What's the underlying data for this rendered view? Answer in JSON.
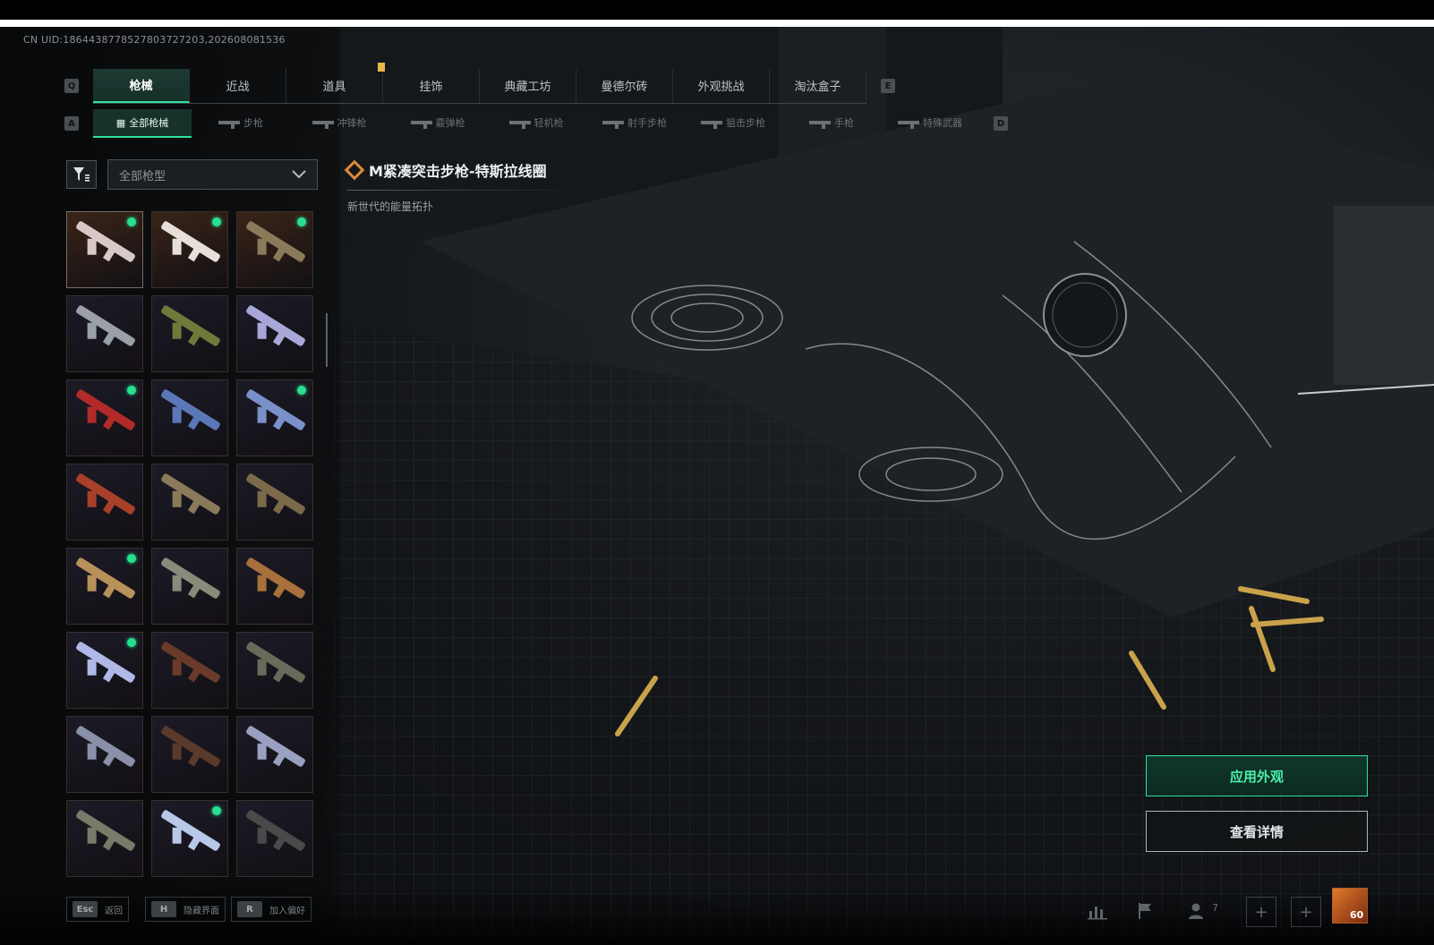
{
  "uid_text": "CN UID:1864438778527803727203,202608081536",
  "main_tabs": [
    {
      "label": "枪械",
      "active": true
    },
    {
      "label": "近战",
      "active": false
    },
    {
      "label": "道具",
      "active": false
    },
    {
      "label": "挂饰",
      "active": false
    },
    {
      "label": "典藏工坊",
      "active": false
    },
    {
      "label": "曼德尔砖",
      "active": false
    },
    {
      "label": "外观挑战",
      "active": false
    },
    {
      "label": "淘汰盒子",
      "active": false
    }
  ],
  "tab_keys": {
    "prev": "Q",
    "next": "E"
  },
  "sub_tabs": [
    {
      "label": "全部枪械",
      "active": true
    },
    {
      "label": "步枪",
      "active": false
    },
    {
      "label": "冲锋枪",
      "active": false
    },
    {
      "label": "霰弹枪",
      "active": false
    },
    {
      "label": "轻机枪",
      "active": false
    },
    {
      "label": "射手步枪",
      "active": false
    },
    {
      "label": "狙击步枪",
      "active": false
    },
    {
      "label": "手枪",
      "active": false
    },
    {
      "label": "特殊武器",
      "active": false
    }
  ],
  "sub_tab_keys": {
    "prev": "A",
    "next": "D"
  },
  "filter": {
    "dropdown_value": "全部枪型"
  },
  "skins": [
    {
      "name": "skin-1",
      "color": "#d8c8c8",
      "bg": "#3a2418",
      "new": true
    },
    {
      "name": "skin-2",
      "color": "#e6e0d8",
      "bg": "#3a2418",
      "new": true
    },
    {
      "name": "skin-3",
      "color": "#8a7a5a",
      "bg": "#3a2418",
      "new": true
    },
    {
      "name": "skin-4",
      "color": "#9aa0a6",
      "bg": "#1c1a26",
      "new": false
    },
    {
      "name": "skin-5",
      "color": "#6f7a3a",
      "bg": "#1c1a26",
      "new": false
    },
    {
      "name": "skin-6",
      "color": "#a8a8d8",
      "bg": "#1c1a26",
      "new": false
    },
    {
      "name": "skin-7",
      "color": "#b22a2a",
      "bg": "#1c1a26",
      "new": true
    },
    {
      "name": "skin-8",
      "color": "#5a78b8",
      "bg": "#1c1a26",
      "new": false
    },
    {
      "name": "skin-9",
      "color": "#7a90c8",
      "bg": "#1c1a26",
      "new": true
    },
    {
      "name": "skin-10",
      "color": "#a8402a",
      "bg": "#1c1a26",
      "new": false
    },
    {
      "name": "skin-11",
      "color": "#8a7a5a",
      "bg": "#1c1a26",
      "new": false
    },
    {
      "name": "skin-12",
      "color": "#7a6a4a",
      "bg": "#1c1a26",
      "new": false
    },
    {
      "name": "skin-13",
      "color": "#b8905a",
      "bg": "#1c1a26",
      "new": true
    },
    {
      "name": "skin-14",
      "color": "#8a8a7a",
      "bg": "#1c1a26",
      "new": false
    },
    {
      "name": "skin-15",
      "color": "#a8703a",
      "bg": "#1c1a26",
      "new": false
    },
    {
      "name": "skin-16",
      "color": "#b0b8e8",
      "bg": "#1c1a26",
      "new": true
    },
    {
      "name": "skin-17",
      "color": "#6a3a2a",
      "bg": "#1c1a26",
      "new": false
    },
    {
      "name": "skin-18",
      "color": "#6a6a5a",
      "bg": "#1c1a26",
      "new": false
    },
    {
      "name": "skin-19",
      "color": "#8a90a8",
      "bg": "#1c1a26",
      "new": false
    },
    {
      "name": "skin-20",
      "color": "#5a3a2a",
      "bg": "#1c1a26",
      "new": false
    },
    {
      "name": "skin-21",
      "color": "#9aa0c0",
      "bg": "#1c1a26",
      "new": false
    },
    {
      "name": "skin-22",
      "color": "#7a7a6a",
      "bg": "#1c1a26",
      "new": false
    },
    {
      "name": "skin-23",
      "color": "#b8c8e8",
      "bg": "#1c1a26",
      "new": true
    },
    {
      "name": "skin-24",
      "color": "#4a4a4a",
      "bg": "#1c1a26",
      "new": false
    }
  ],
  "selected_item": {
    "title": "M紧凑突击步枪-特斯拉线圈",
    "description": "新世代的能量拓扑"
  },
  "actions": {
    "apply": "应用外观",
    "details": "查看详情"
  },
  "bottom_hints": [
    {
      "key": "Esc",
      "label": "返回"
    },
    {
      "key": "H",
      "label": "隐藏界面"
    },
    {
      "key": "R",
      "label": "加入偏好"
    }
  ],
  "status": {
    "friend_count": "7",
    "level": "60"
  },
  "colors": {
    "accent": "#2fe39d",
    "new_dot": "#27e08f",
    "title_icon": "#e08a3a"
  }
}
